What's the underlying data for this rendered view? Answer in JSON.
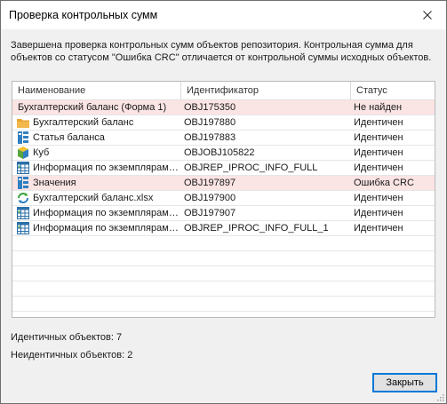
{
  "window": {
    "title": "Проверка контрольных сумм"
  },
  "description": "Завершена проверка контрольных сумм объектов репозитория. Контрольная сумма для объектов со статусом \"Ошибка CRC\" отличается от контрольной суммы исходных объектов.",
  "grid": {
    "columns": [
      "Наименование",
      "Идентификатор",
      "Статус"
    ],
    "rows": [
      {
        "name": "Бухгалтерский баланс (Форма 1)",
        "id": "OBJ175350",
        "status": "Не найден",
        "icon": "none",
        "error": true
      },
      {
        "name": "Бухгалтерский баланс",
        "id": "OBJ197880",
        "status": "Идентичен",
        "icon": "folder-icon",
        "error": false
      },
      {
        "name": "Статья баланса",
        "id": "OBJ197883",
        "status": "Идентичен",
        "icon": "dictionary-icon",
        "error": false
      },
      {
        "name": "Куб",
        "id": "OBJOBJ105822",
        "status": "Идентичен",
        "icon": "cube-icon",
        "error": false
      },
      {
        "name": "Информация по экземплярам объектов",
        "id": "OBJREP_IPROC_INFO_FULL",
        "status": "Идентичен",
        "icon": "table-icon",
        "error": false
      },
      {
        "name": "Значения",
        "id": "OBJ197897",
        "status": "Ошибка CRC",
        "icon": "dictionary-icon",
        "error": true
      },
      {
        "name": "Бухгалтерский баланс.xlsx",
        "id": "OBJ197900",
        "status": "Идентичен",
        "icon": "refresh-doc-icon",
        "error": false
      },
      {
        "name": "Информация по экземплярам объектов",
        "id": "OBJ197907",
        "status": "Идентичен",
        "icon": "table-icon",
        "error": false
      },
      {
        "name": "Информация по экземплярам объектов",
        "id": "OBJREP_IPROC_INFO_FULL_1",
        "status": "Идентичен",
        "icon": "table-icon",
        "error": false
      }
    ]
  },
  "stats": {
    "identical": "Идентичных объектов: 7",
    "non_identical": "Неидентичных объектов: 2"
  },
  "buttons": {
    "close": "Закрыть"
  },
  "colors": {
    "error_row": "#fbe4e4",
    "accent": "#0078d7"
  }
}
